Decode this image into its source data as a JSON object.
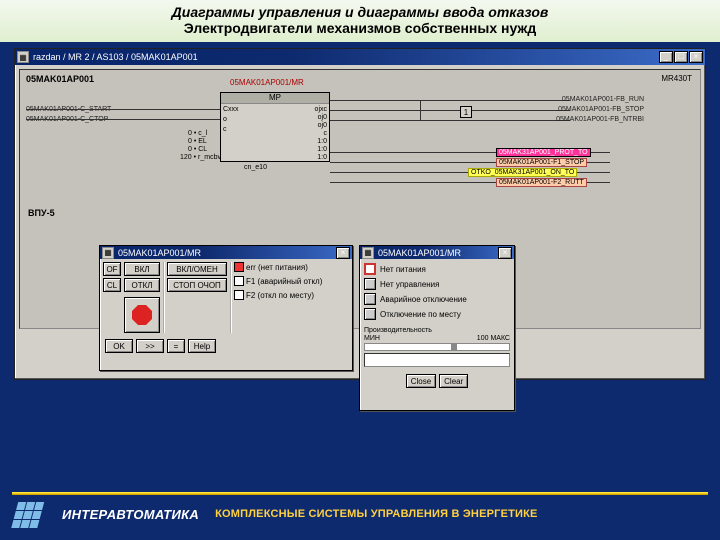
{
  "header": {
    "line1": "Диаграммы управления и диаграммы ввода отказов",
    "line2": "Электродвигатели механизмов собственных нужд"
  },
  "window": {
    "title": "razdan / MR 2 / AS103 / 05MAK01AP001",
    "controls": {
      "min": "_",
      "max": "□",
      "close": "×"
    }
  },
  "diagram": {
    "top_label": "05MAK01AP001",
    "center_label": "05MAK01AP001/MR",
    "block_header": "MP",
    "left_pins": [
      "o",
      "Cxxx",
      "c"
    ],
    "right_pins": [
      "ojxc",
      "oj0",
      "oj0",
      "c",
      "1:0",
      "1:0",
      "1:0"
    ],
    "left_inputs": [
      "0 • c_l",
      "0 • EL",
      "0 • CL",
      "120 • r_mcbv"
    ],
    "far_right": [
      "cn_e10"
    ],
    "one_marker": "1",
    "left_signals": [
      "05MAK01AP001-C_START",
      "05MAK01AP001-C_CTOP"
    ],
    "right_signals": [
      "05MAK01AP001-FB_RUN",
      "05MAK01AP001-FB_STOP",
      "05MAK01AP001-FB_NTRBI"
    ],
    "tags": [
      "05MAK31AP001_PROT_TO",
      "05MAK01AP001-F1_STOP",
      "OTKO_05MAK31AP001_ON_TO",
      "05MAK01AP001-F2_RUTT"
    ],
    "vpu": "ВПУ-5",
    "top_right": "MR430T"
  },
  "dlg1": {
    "title": "05MAK01AP001/MR",
    "of": "OF",
    "cl": "CL",
    "on": "ВКЛ",
    "off": "ОТКЛ",
    "cancel": "ВКЛ/ОМЕН",
    "stop_now": "СТОП ОЧОП",
    "faults": [
      "err (нет питания)",
      "F1 (аварийный откл)",
      "F2 (откл по месту)"
    ],
    "ok": "OK",
    "fwd": ">>",
    "eq": "=",
    "help": "Help"
  },
  "dlg2": {
    "title": "05MAK01AP001/MR",
    "items": [
      "Нет питания",
      "Нет управления",
      "Аварийное отключение",
      "Отключение по месту"
    ],
    "prod_label": "Производительность",
    "min": "МИН",
    "max": "МАКС",
    "pct": "100",
    "close": "Close",
    "clear": "Clear"
  },
  "footer": {
    "brand": "ИНТЕРАВТОМАТИКА",
    "tagline": "КОМПЛЕКСНЫЕ СИСТЕМЫ УПРАВЛЕНИЯ В ЭНЕРГЕТИКЕ"
  }
}
